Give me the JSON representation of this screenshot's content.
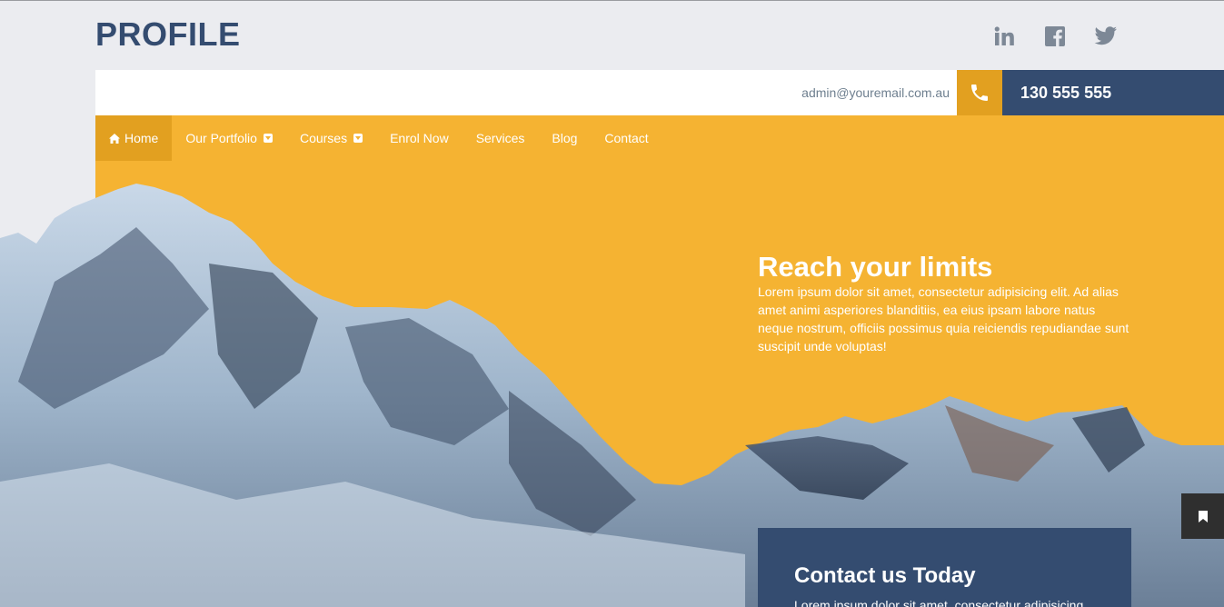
{
  "brand": {
    "logo_text": "PROFILE"
  },
  "social": [
    {
      "name": "linkedin-icon",
      "label": "in"
    },
    {
      "name": "facebook-icon",
      "label": "f"
    },
    {
      "name": "twitter-icon",
      "label": "twitter"
    }
  ],
  "contact_bar": {
    "email": "admin@youremail.com.au",
    "phone_icon": "phone-icon",
    "phone": "130 555 555"
  },
  "nav": {
    "items": [
      {
        "label": "Home",
        "icon": "home-icon",
        "active": true
      },
      {
        "label": "Our Portfolio",
        "dropdown": true
      },
      {
        "label": "Courses",
        "dropdown": true
      },
      {
        "label": "Enrol Now"
      },
      {
        "label": "Services"
      },
      {
        "label": "Blog"
      },
      {
        "label": "Contact"
      }
    ]
  },
  "hero": {
    "title": "Reach your limits",
    "text": "Lorem ipsum dolor sit amet, consectetur adipisicing elit. Ad alias amet animi asperiores blanditiis, ea eius ipsam labore natus neque nostrum, officiis possimus quia reiciendis repudiandae sunt suscipit unde voluptas!"
  },
  "contact_card": {
    "title": "Contact us Today",
    "text": "Lorem ipsum dolor sit amet, consectetur adipisicing"
  },
  "floating": {
    "bookmark_icon": "bookmark-icon"
  },
  "colors": {
    "brand_blue": "#344c70",
    "accent_yellow": "#f5b332",
    "accent_dark_yellow": "#e2a020",
    "page_bg": "#ebecf0"
  }
}
